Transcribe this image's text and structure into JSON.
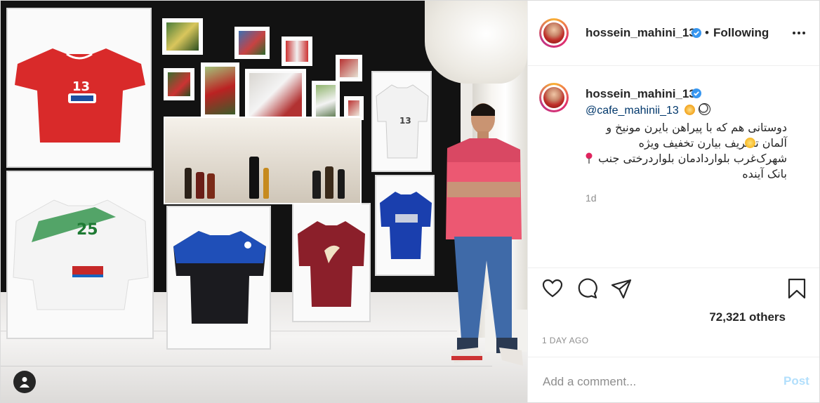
{
  "post": {
    "author": {
      "username": "hossein_mahini_13",
      "verified": true,
      "follow_status": "Following",
      "separator": "•"
    },
    "caption": {
      "username": "hossein_mahini_13",
      "mention": "@cafe_mahinii_13",
      "lines": [
        "دوستانی هم که با پیراهن بایرن مونیخ و",
        "آلمان تشریف بیارن تخفیف ویژه",
        "شهرک‌غرب بلواردادمان بلواردرختی جنب",
        "بانک آینده"
      ],
      "time_ago": "1d"
    },
    "likes": "72,321 others",
    "date": "1 DAY AGO",
    "comment": {
      "placeholder": "Add a comment...",
      "post_label": "Post"
    },
    "photo": {
      "jerseys": [
        {
          "number": "13",
          "color": "#d92a2a"
        },
        {
          "number": "25",
          "color": "#f4f4f4"
        },
        {
          "number": "13",
          "color": "#f2f2f2"
        }
      ]
    },
    "icons": {
      "more": "more-options-icon",
      "like": "heart-icon",
      "comment": "comment-icon",
      "share": "paper-plane-icon",
      "save": "bookmark-icon",
      "verified": "verified-badge-icon",
      "user": "user-tag-icon"
    },
    "colors": {
      "verified_blue": "#3897f0",
      "mention_blue": "#00376b",
      "post_button_disabled": "#b2dffc",
      "meta_gray": "#8e8e8e"
    }
  }
}
